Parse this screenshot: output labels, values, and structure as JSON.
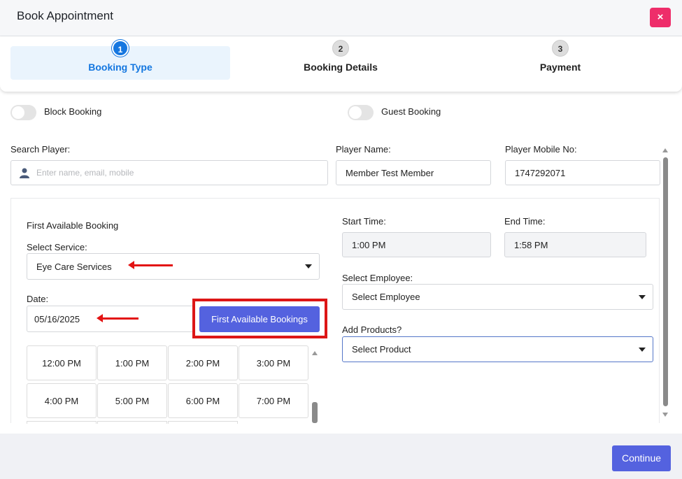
{
  "dialog": {
    "title": "Book Appointment",
    "close_label": "×"
  },
  "steps": [
    {
      "number": "1",
      "label": "Booking Type"
    },
    {
      "number": "2",
      "label": "Booking Details"
    },
    {
      "number": "3",
      "label": "Payment"
    }
  ],
  "toggles": {
    "block_booking": "Block Booking",
    "guest_booking": "Guest Booking"
  },
  "player": {
    "search_label": "Search Player:",
    "search_placeholder": "Enter name, email, mobile",
    "name_label": "Player Name:",
    "name_value": "Member Test Member",
    "mobile_label": "Player Mobile No:",
    "mobile_value": "1747292071"
  },
  "booking": {
    "section_title": "First Available Booking",
    "service_label": "Select Service:",
    "service_value": "Eye Care Services",
    "date_label": "Date:",
    "date_value": "05/16/2025",
    "first_available_button": "First Available Bookings",
    "time_slots": [
      "12:00 PM",
      "1:00 PM",
      "2:00 PM",
      "3:00 PM",
      "4:00 PM",
      "5:00 PM",
      "6:00 PM",
      "7:00 PM"
    ]
  },
  "details": {
    "start_label": "Start Time:",
    "start_value": "1:00 PM",
    "end_label": "End Time:",
    "end_value": "1:58 PM",
    "employee_label": "Select Employee:",
    "employee_value": "Select Employee",
    "products_label": "Add Products?",
    "products_value": "Select Product"
  },
  "footer": {
    "continue_label": "Continue"
  },
  "colors": {
    "primary": "#5462df",
    "step_active": "#1677e0",
    "close": "#ee2d6a",
    "annotation": "#e31313"
  }
}
